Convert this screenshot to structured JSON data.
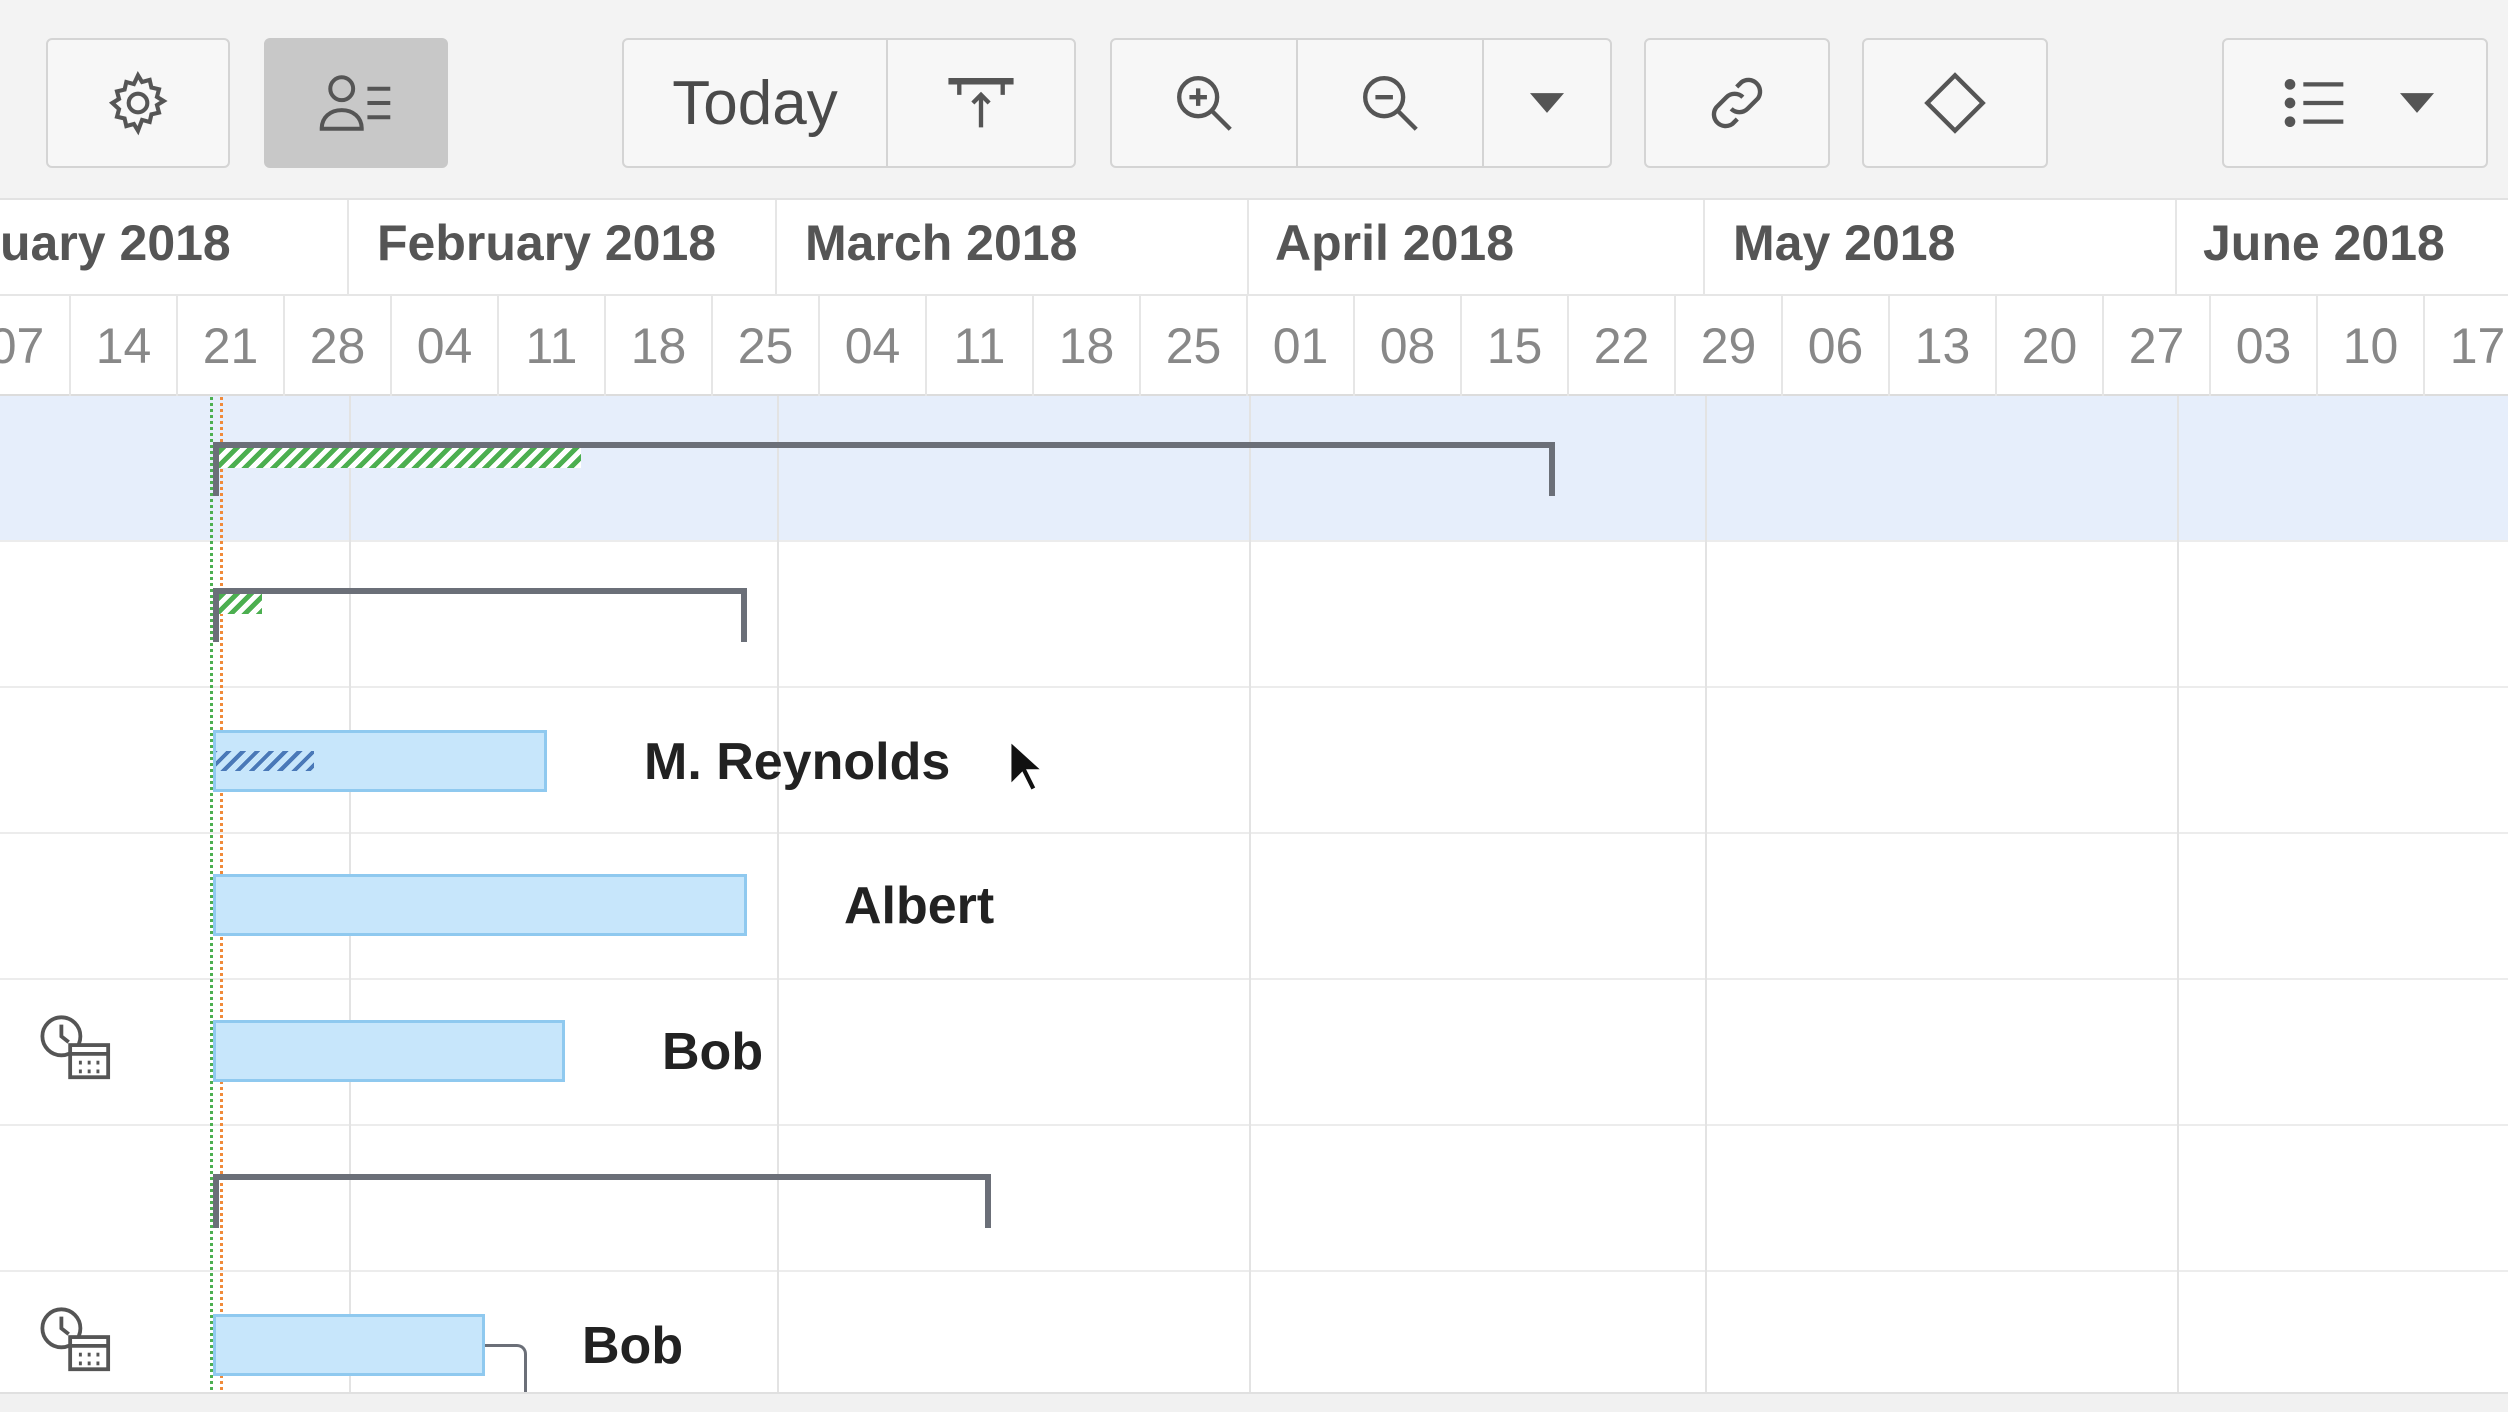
{
  "toolbar": {
    "settings_icon": "gear-icon",
    "resource_view_icon": "user-list-icon",
    "today_label": "Today",
    "scroll_to_top_icon": "scroll-to-task-icon",
    "zoom_in_icon": "zoom-in-icon",
    "zoom_out_icon": "zoom-out-icon",
    "zoom_dropdown_icon": "caret-down-icon",
    "link_icon": "link-icon",
    "milestone_icon": "diamond-icon",
    "list_options_icon": "list-icon"
  },
  "timeline": {
    "months": [
      {
        "label": "uary 2018"
      },
      {
        "label": "February 2018"
      },
      {
        "label": "March 2018"
      },
      {
        "label": "April 2018"
      },
      {
        "label": "May 2018"
      },
      {
        "label": "June 2018"
      }
    ],
    "weeks": [
      "07",
      "14",
      "21",
      "28",
      "04",
      "11",
      "18",
      "25",
      "04",
      "11",
      "18",
      "25",
      "01",
      "08",
      "15",
      "22",
      "29",
      "06",
      "13",
      "20",
      "27",
      "03",
      "10",
      "17"
    ]
  },
  "rows": [
    {
      "type": "summary",
      "selected": true,
      "progress_pct": 27
    },
    {
      "type": "summary",
      "selected": false,
      "progress_pct": 8
    },
    {
      "type": "task",
      "assignee": "M. Reynolds",
      "progress_pct": 30
    },
    {
      "type": "task",
      "assignee": "Albert",
      "progress_pct": 0
    },
    {
      "type": "task",
      "assignee": "Bob",
      "progress_pct": 0,
      "icon": "clock-calendar-icon"
    },
    {
      "type": "summary",
      "selected": false,
      "progress_pct": 0
    },
    {
      "type": "task",
      "assignee": "Bob",
      "progress_pct": 0,
      "icon": "clock-calendar-icon"
    }
  ],
  "colors": {
    "task_bar": "#c7e6fb",
    "task_border": "#8fc9ef",
    "summary_bracket": "#6b6f78",
    "progress_summary": "#4caf50",
    "progress_task": "#4a79b8",
    "today_marker_green": "#4caf50",
    "today_marker_orange": "#f08a3a",
    "selected_row": "#e6eefb"
  }
}
